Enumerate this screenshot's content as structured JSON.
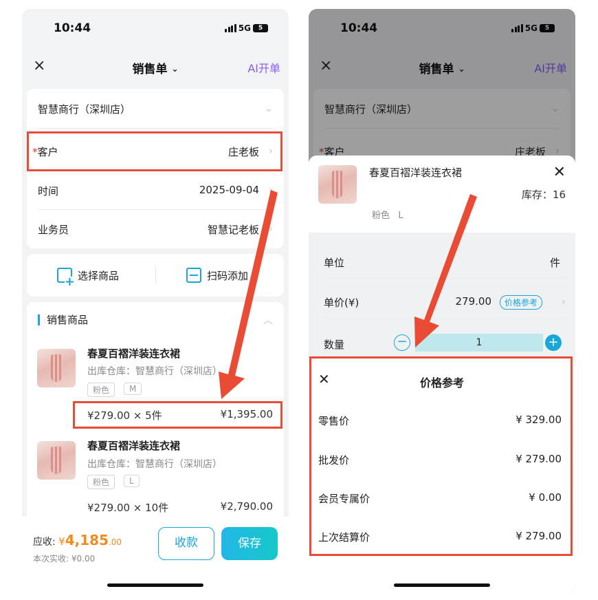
{
  "status": {
    "time": "10:44",
    "network": "5G",
    "battery": "5"
  },
  "nav": {
    "close": "×",
    "title": "销售单",
    "title_chevron": "⌄",
    "ai_link": "AI开单"
  },
  "form": {
    "store": "智慧商行（深圳店）",
    "customer": {
      "required": "*",
      "label": "客户",
      "value": "庄老板"
    },
    "time": {
      "label": "时间",
      "value": "2025-09-04"
    },
    "salesperson": {
      "label": "业务员",
      "value": "智慧记老板"
    },
    "arrow": "›",
    "dropdown": "⌄"
  },
  "actions": {
    "select_goods": "选择商品",
    "scan_add": "扫码添加"
  },
  "section": {
    "title": "销售商品",
    "toggle": "︿"
  },
  "products": [
    {
      "name": "春夏百褶洋装连衣裙",
      "warehouse": "出库仓库：智慧商行（深圳店）",
      "color": "粉色",
      "size": "M",
      "price_qty": "¥279.00 × 5件",
      "total": "¥1,395.00"
    },
    {
      "name": "春夏百褶洋装连衣裙",
      "warehouse": "出库仓库：智慧商行（深圳店）",
      "color": "粉色",
      "size": "L",
      "price_qty": "¥279.00 × 10件",
      "total": "¥2,790.00"
    }
  ],
  "footer": {
    "due_label": "应收:",
    "due_currency": "¥",
    "due_int": "4,185",
    "due_dec": ".00",
    "paid": "本次实收: ¥0.00",
    "collect": "收款",
    "save": "保存"
  },
  "sheet": {
    "product_name": "春夏百褶洋装连衣裙",
    "close": "✕",
    "stock": "库存：16",
    "spec_color": "粉色",
    "spec_size": "L",
    "unit_label": "单位",
    "unit_value": "件",
    "price_label": "单价(¥)",
    "price_value": "279.00",
    "price_ref_badge": "价格参考",
    "qty_label": "数量",
    "qty_value": "1",
    "minus": "−",
    "plus": "+"
  },
  "popup": {
    "close": "✕",
    "title": "价格参考",
    "rows": [
      {
        "label": "零售价",
        "value": "¥ 329.00"
      },
      {
        "label": "批发价",
        "value": "¥ 279.00"
      },
      {
        "label": "会员专属价",
        "value": "¥ 0.00"
      },
      {
        "label": "上次结算价",
        "value": "¥ 279.00"
      }
    ]
  },
  "colors": {
    "accent": "#19a6d8",
    "highlight": "#e94b35",
    "amount": "#f08c1e",
    "ai": "#8a5cf6"
  }
}
